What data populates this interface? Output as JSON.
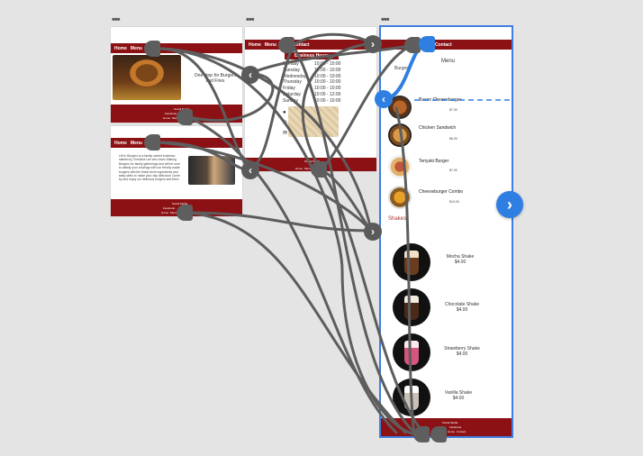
{
  "colors": {
    "brand": "#8c1114",
    "selection": "#3d7fe0",
    "wire": "#5d5d5d",
    "canvas": "#e4e4e4"
  },
  "handles": [
    "•••",
    "•••",
    "•••",
    "•••"
  ],
  "home": {
    "nav": [
      "Home",
      "Menu"
    ],
    "tagline": "One stop for Burgers and Fries",
    "footer": [
      "Social Media",
      "Facebook",
      "Home",
      "Menu"
    ]
  },
  "about": {
    "nav": [
      "Home",
      "Menu"
    ],
    "body": "Lift In Burgers is a family owned business started by Christina Lee who loves Making Burgers for family gatherings and will be sure to satisfy your cravings with our freshly made burgers with the finest fresh ingredients and tasty sides to make your day delicious! Come by and enjoy our delicious burgers and fries!",
    "footer": [
      "Social Media",
      "Facebook",
      "Home",
      "Menu"
    ]
  },
  "contact": {
    "nav": [
      "Home",
      "Menu",
      "Contact"
    ],
    "hours_title": "Business Hours",
    "days": [
      "Monday",
      "Tuesday",
      "Wednesday",
      "Thursday",
      "Friday",
      "Saturday",
      "Sunday"
    ],
    "times": [
      "10:00 - 10:00",
      "10:00 - 10:00",
      "10:00 - 10:00",
      "10:00 - 10:00",
      "10:00 - 10:00",
      "10:00 - 12:00",
      "10:00 - 10:00"
    ],
    "footer": [
      "Social Media",
      "Home",
      "Menu",
      "Contact"
    ]
  },
  "menu": {
    "nav_right": "Contact",
    "title": "Menu",
    "section_burgers": "Burgers",
    "items": [
      {
        "name": "Bacon Cheeseburger",
        "price": "$7.00"
      },
      {
        "name": "Chicken Sandwich",
        "price": "$6.00"
      },
      {
        "name": "Teriyaki Burger",
        "price": "$7.00"
      },
      {
        "name": "Cheeseburger Combo",
        "price": "$10.00"
      }
    ],
    "section_shakes": "Shakes",
    "shakes": [
      {
        "name": "Mocha Shake",
        "price": "$4.00"
      },
      {
        "name": "Chocolate Shake",
        "price": "$4.00"
      },
      {
        "name": "Strawberry Shake",
        "price": "$4.00"
      },
      {
        "name": "Vanilla Shake",
        "price": "$4.00"
      }
    ],
    "footer": [
      "Social Media",
      "Facebook",
      "Home",
      "Contact"
    ]
  },
  "icons": {
    "back": "chevron-left-icon",
    "next": "chevron-right-icon"
  }
}
